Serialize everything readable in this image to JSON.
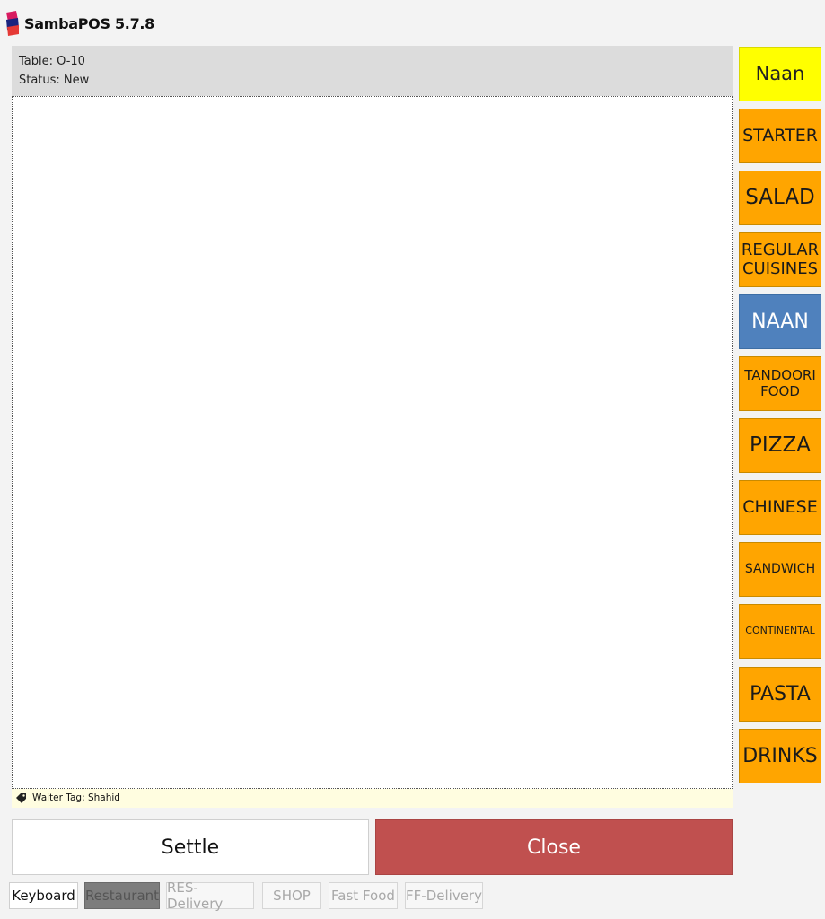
{
  "app": {
    "title": "SambaPOS 5.7.8"
  },
  "ticket": {
    "table": "Table: O-10",
    "status": "Status: New",
    "waiter_tag": "Waiter Tag: Shahid"
  },
  "actions": {
    "settle": "Settle",
    "close": "Close"
  },
  "departments": {
    "keyboard": "Keyboard",
    "restaurant": "Restaurant",
    "res_delivery": "RES-Delivery",
    "shop": "SHOP",
    "fast_food": "Fast Food",
    "ff_delivery": "FF-Delivery"
  },
  "categories": {
    "selected_item": "Naan",
    "starter": "STARTER",
    "salad": "SALAD",
    "regular_cuisines": "REGULAR CUISINES",
    "naan": "NAAN",
    "tandoori_food": "TANDOORI FOOD",
    "pizza": "PIZZA",
    "chinese": "CHINESE",
    "sandwich": "SANDWICH",
    "continental": "CONTINENTAL",
    "pasta": "PASTA",
    "drinks": "DRINKS"
  },
  "colors": {
    "category": "#ffa500",
    "selected_category": "#4f81bd",
    "selected_item": "#ffff00",
    "close_button": "#c0504f",
    "tag_bar": "#fffde0"
  }
}
